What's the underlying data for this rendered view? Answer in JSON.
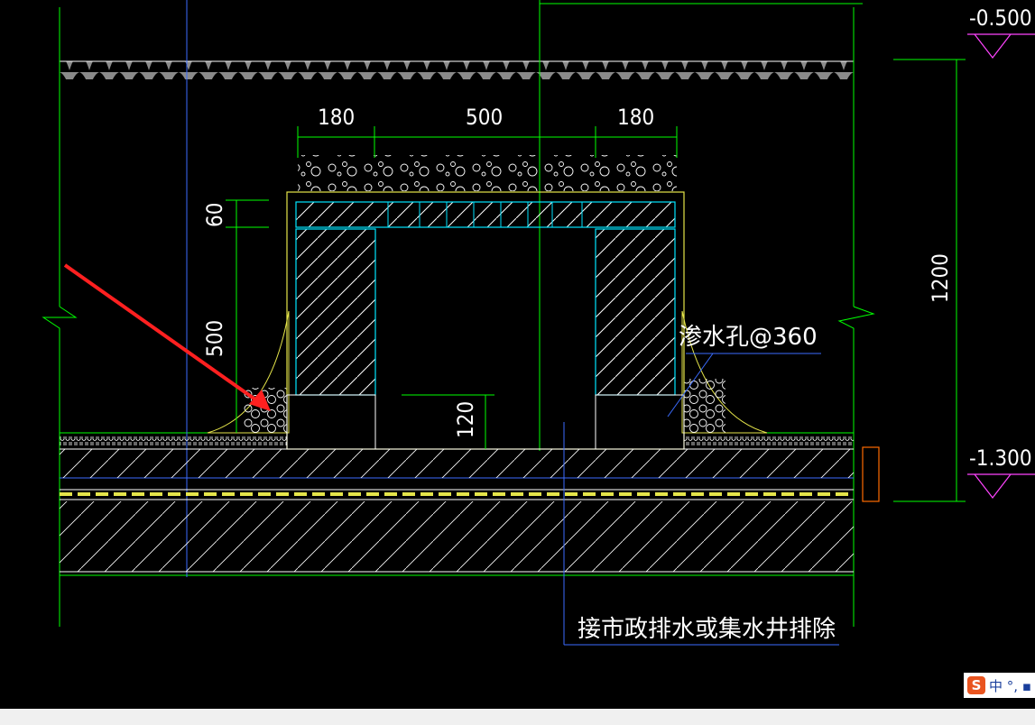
{
  "drawing": {
    "top_dims": [
      "180",
      "500",
      "180"
    ],
    "dim_cover": "60",
    "dim_wall": "500",
    "dim_depth": "1200",
    "dim_step": "120",
    "level_top": "-0.500",
    "level_bottom": "-1.300",
    "note_seep": "渗水孔@360",
    "note_outlet": "接市政排水或集水井排除"
  },
  "ime": {
    "logo": "S",
    "text": "中 °, ▪"
  },
  "colors": {
    "background": "#000000",
    "green": "#00ff00",
    "blue": "#3b6cff",
    "cyan": "#00e5ff",
    "yellow": "#e5e54a",
    "magenta": "#ff44ff",
    "white": "#ffffff",
    "arrow": "#ff2020"
  }
}
